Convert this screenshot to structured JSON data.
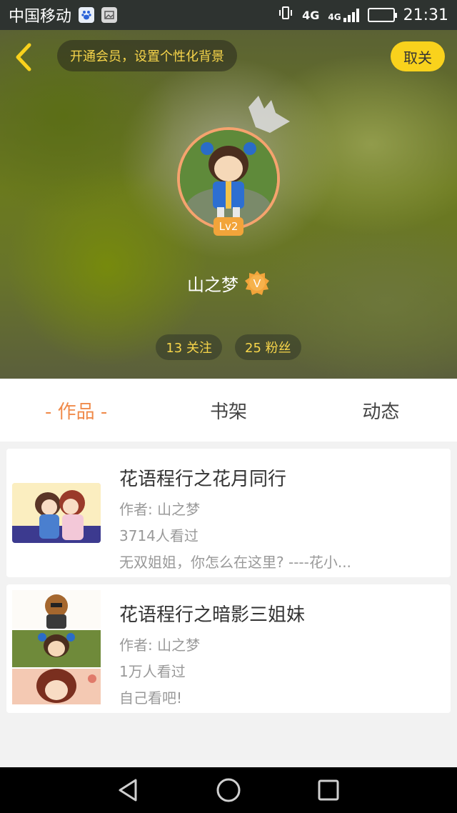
{
  "status_bar": {
    "carrier": "中国移动",
    "network_1": "4G",
    "network_2": "4G",
    "time": "21:31",
    "battery_level": 1.0,
    "colors": {
      "battery": "#3cc03c"
    }
  },
  "header": {
    "vip_tip": "开通会员，设置个性化背景",
    "close_label": "取关",
    "level": "Lv2",
    "username": "山之梦",
    "verified_badge": "V",
    "stats": [
      {
        "label": "13 关注"
      },
      {
        "label": "25 粉丝"
      }
    ],
    "colors": {
      "accent": "#f9d21c",
      "avatar_border": "#f5a36e",
      "stat_text": "#f7d54a"
    }
  },
  "tabs": [
    {
      "label": "- 作品 -",
      "active": true
    },
    {
      "label": "书架",
      "active": false
    },
    {
      "label": "动态",
      "active": false
    }
  ],
  "works": [
    {
      "title": "花语程行之花月同行",
      "author": "作者: 山之梦",
      "views": "3714人看过",
      "desc": "无双姐姐，你怎么在这里? ----花小..."
    },
    {
      "title": "花语程行之暗影三姐妹",
      "author": "作者: 山之梦",
      "views": "1万人看过",
      "desc": "自己看吧!"
    }
  ],
  "icons": {
    "back": "chevron-left-icon",
    "crown": "crown-icon",
    "nav_back": "triangle-back-icon",
    "nav_home": "circle-home-icon",
    "nav_recent": "square-recent-icon"
  },
  "colors": {
    "active_tab": "#f08a4a"
  }
}
